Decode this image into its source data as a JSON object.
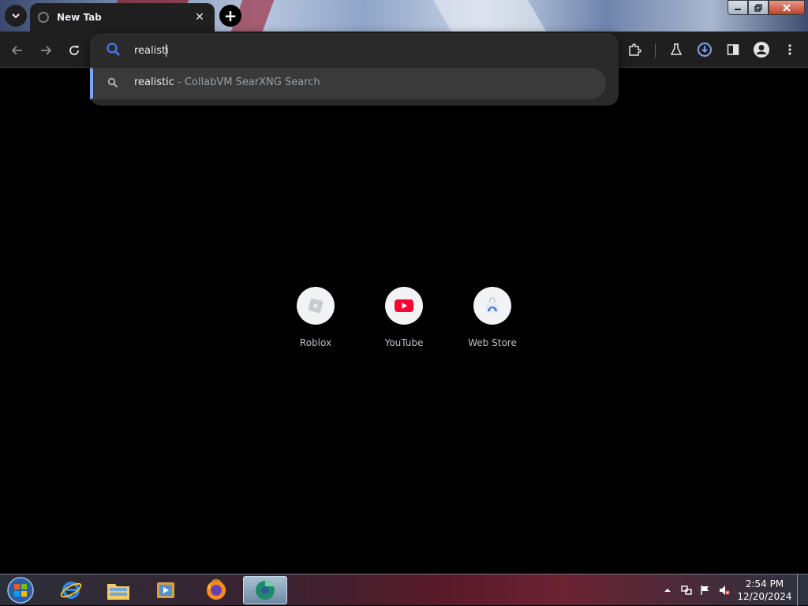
{
  "browser": {
    "tab": {
      "title": "New Tab",
      "close": "✕"
    },
    "new_tab": "+",
    "tab_search": "⌄"
  },
  "window_controls": {
    "minimize": "—",
    "maximize": "❐",
    "close": "✕"
  },
  "omnibox": {
    "typed_text": "realisti",
    "suggestion": {
      "query": "realistic",
      "separator": " - ",
      "source": "CollabVM SearXNG Search"
    }
  },
  "shortcuts": [
    {
      "label": "Roblox"
    },
    {
      "label": "YouTube"
    },
    {
      "label": "Web Store"
    }
  ],
  "taskbar": {
    "time": "2:54 PM",
    "date": "12/20/2024"
  },
  "colors": {
    "accent": "#7ba4f4",
    "youtube_red": "#ff0033",
    "omnibox_icon": "#4a6ee0"
  }
}
